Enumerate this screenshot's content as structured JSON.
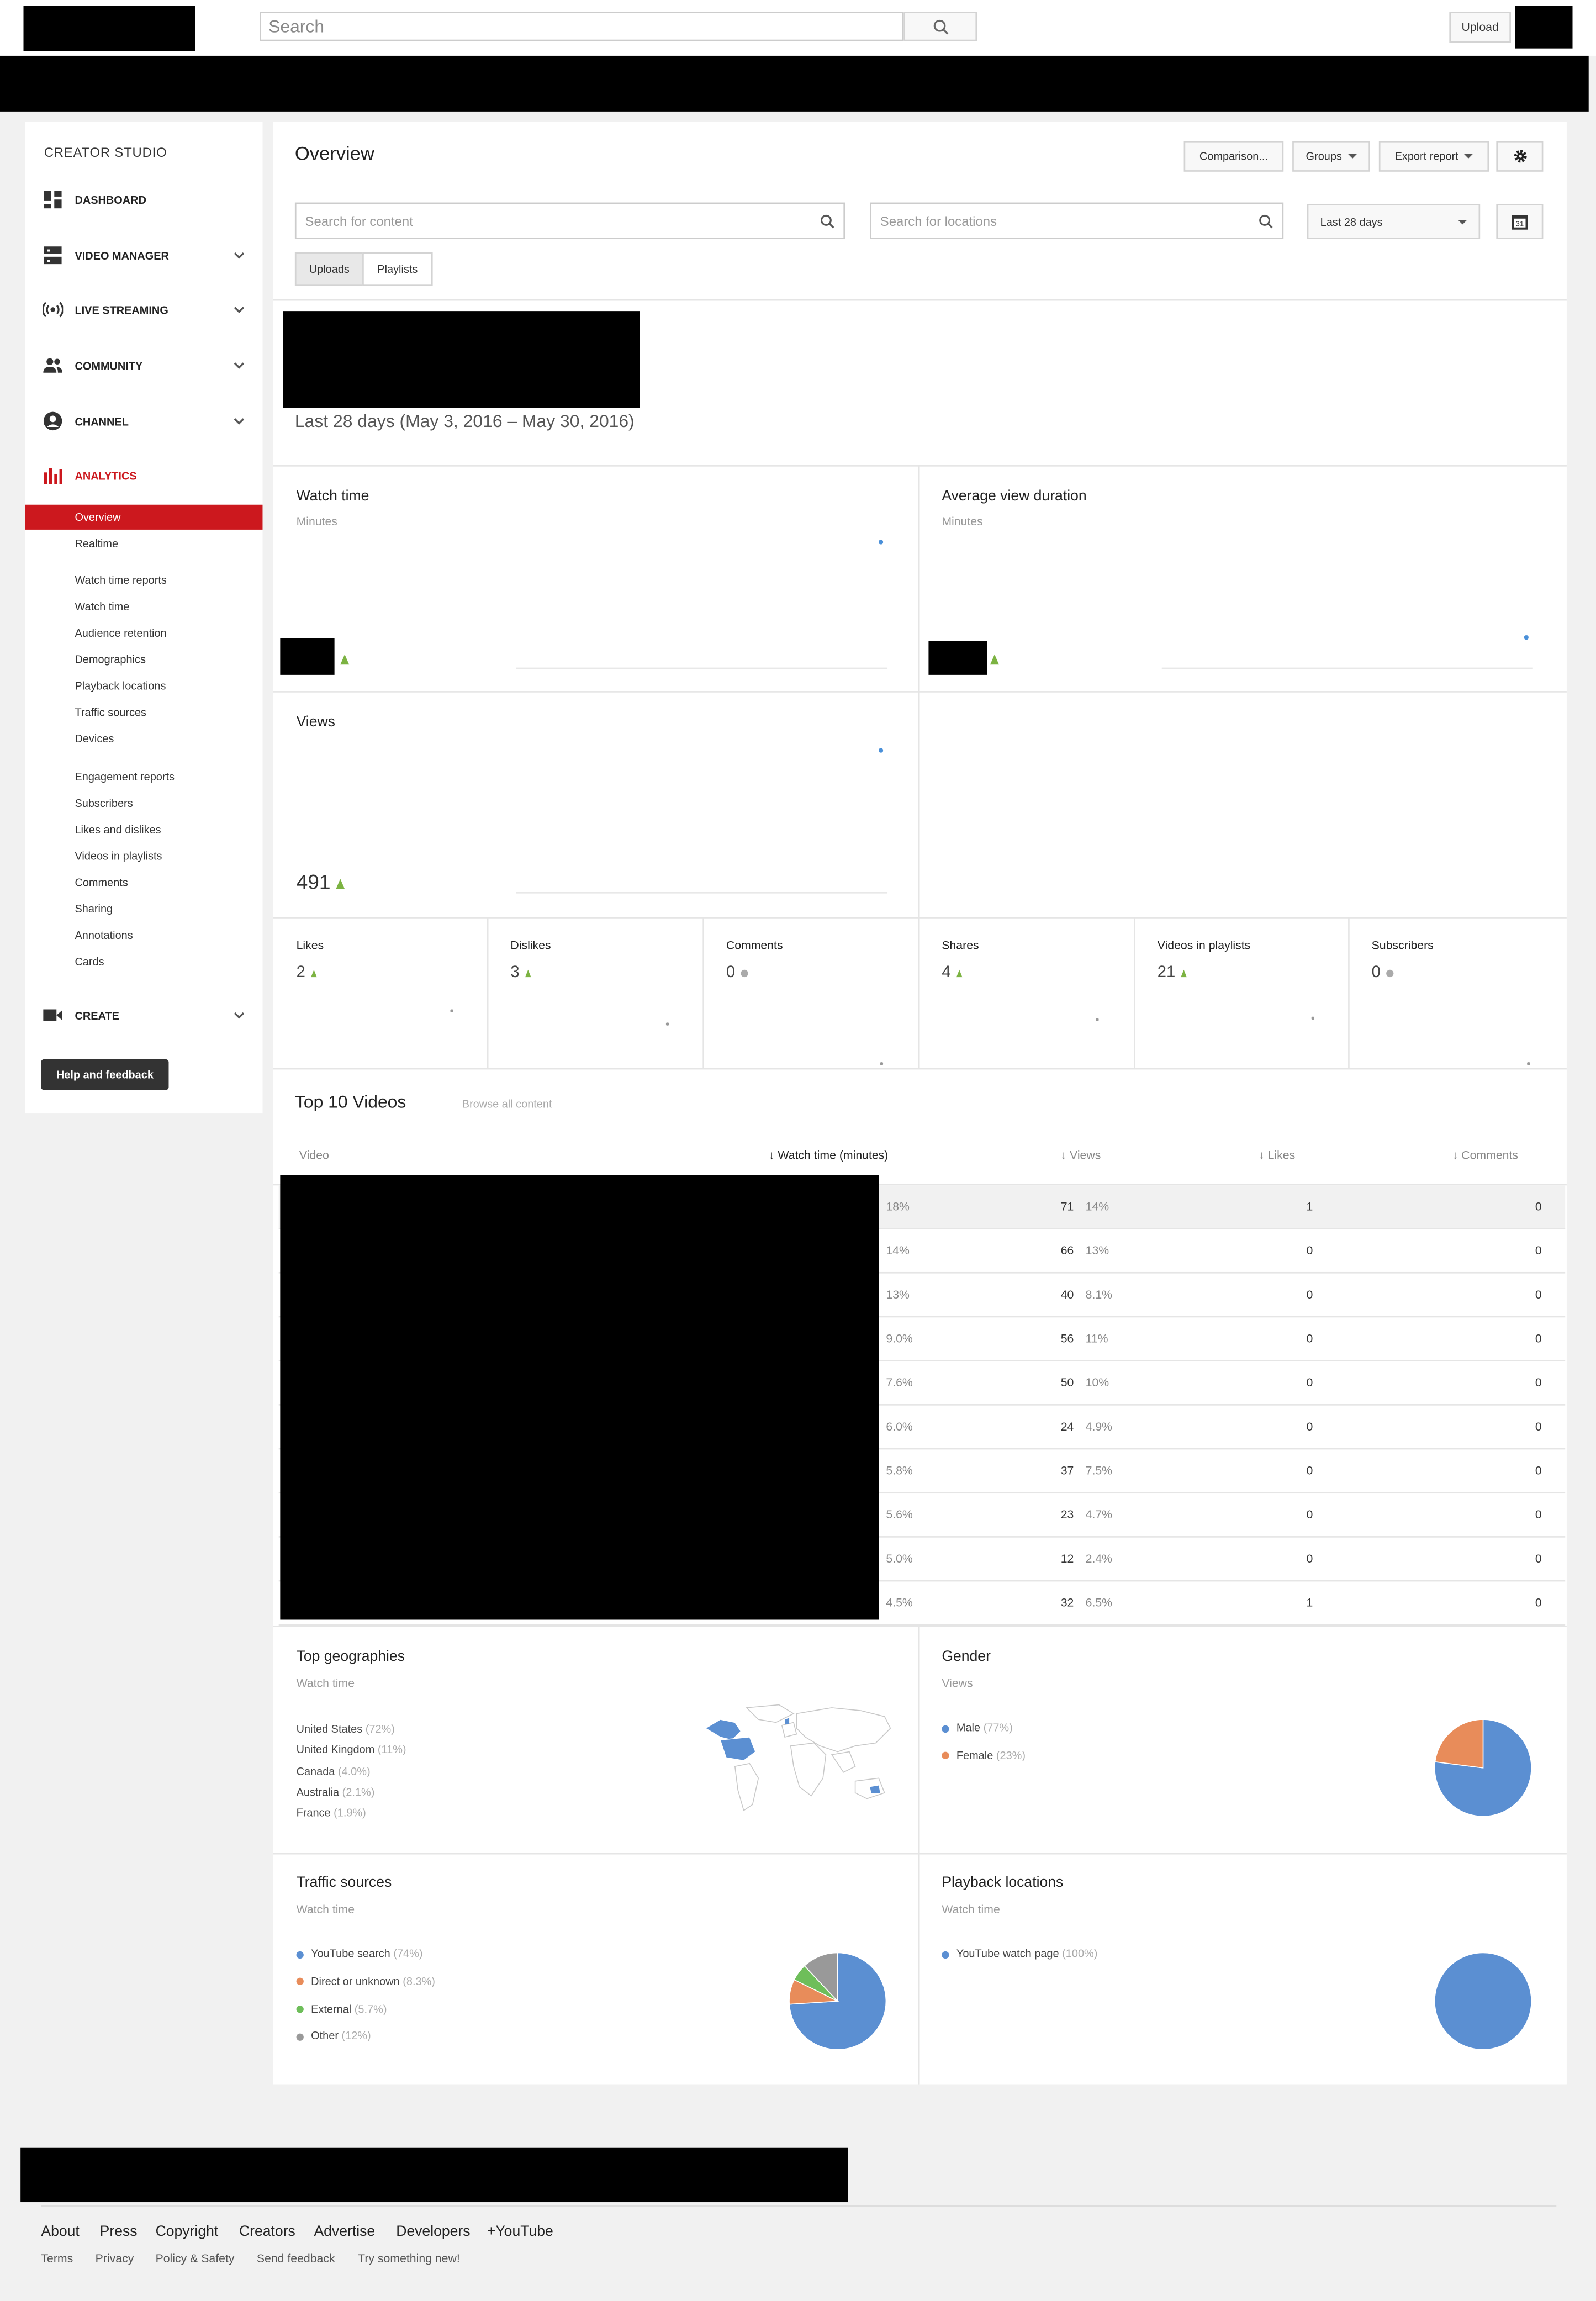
{
  "masthead": {
    "search_placeholder": "Search",
    "upload_label": "Upload"
  },
  "sidebar": {
    "title": "CREATOR STUDIO",
    "sections": {
      "dashboard": "DASHBOARD",
      "video_manager": "VIDEO MANAGER",
      "live_streaming": "LIVE STREAMING",
      "community": "COMMUNITY",
      "channel": "CHANNEL",
      "analytics": "ANALYTICS",
      "create": "CREATE"
    },
    "analytics_items": [
      "Overview",
      "Realtime",
      "Watch time reports",
      "Watch time",
      "Audience retention",
      "Demographics",
      "Playback locations",
      "Traffic sources",
      "Devices",
      "Engagement reports",
      "Subscribers",
      "Likes and dislikes",
      "Videos in playlists",
      "Comments",
      "Sharing",
      "Annotations",
      "Cards"
    ],
    "help_label": "Help and feedback"
  },
  "main": {
    "title": "Overview",
    "buttons": {
      "comparison": "Comparison...",
      "groups": "Groups",
      "export": "Export report"
    },
    "content_search_placeholder": "Search for content",
    "location_search_placeholder": "Search for locations",
    "date_select": "Last 28 days",
    "calendar_day": "31",
    "toggle": {
      "uploads": "Uploads",
      "playlists": "Playlists"
    },
    "date_range": "Last 28 days (May 3, 2016 – May 30, 2016)",
    "metrics": {
      "watch_time": {
        "title": "Watch time",
        "unit": "Minutes"
      },
      "avg_view_duration": {
        "title": "Average view duration",
        "unit": "Minutes"
      },
      "views": {
        "title": "Views",
        "value": "491"
      }
    },
    "mini_metrics": [
      {
        "title": "Likes",
        "value": "2",
        "trend": "up"
      },
      {
        "title": "Dislikes",
        "value": "3",
        "trend": "up"
      },
      {
        "title": "Comments",
        "value": "0",
        "trend": "flat"
      },
      {
        "title": "Shares",
        "value": "4",
        "trend": "up"
      },
      {
        "title": "Videos in playlists",
        "value": "21",
        "trend": "up"
      },
      {
        "title": "Subscribers",
        "value": "0",
        "trend": "flat"
      }
    ],
    "top_videos": {
      "title": "Top 10 Videos",
      "browse_link": "Browse all content",
      "headers": {
        "video": "Video",
        "watch_time": "Watch time (minutes)",
        "views": "Views",
        "likes": "Likes",
        "comments": "Comments"
      },
      "rows": [
        {
          "watch_pct": "18%",
          "views": "71",
          "views_pct": "14%",
          "likes": "1",
          "comments": "0"
        },
        {
          "watch_pct": "14%",
          "views": "66",
          "views_pct": "13%",
          "likes": "0",
          "comments": "0"
        },
        {
          "watch_pct": "13%",
          "views": "40",
          "views_pct": "8.1%",
          "likes": "0",
          "comments": "0"
        },
        {
          "watch_pct": "9.0%",
          "views": "56",
          "views_pct": "11%",
          "likes": "0",
          "comments": "0"
        },
        {
          "watch_pct": "7.6%",
          "views": "50",
          "views_pct": "10%",
          "likes": "0",
          "comments": "0"
        },
        {
          "watch_pct": "6.0%",
          "views": "24",
          "views_pct": "4.9%",
          "likes": "0",
          "comments": "0"
        },
        {
          "watch_pct": "5.8%",
          "views": "37",
          "views_pct": "7.5%",
          "likes": "0",
          "comments": "0"
        },
        {
          "watch_pct": "5.6%",
          "views": "23",
          "views_pct": "4.7%",
          "likes": "0",
          "comments": "0"
        },
        {
          "watch_pct": "5.0%",
          "views": "12",
          "views_pct": "2.4%",
          "likes": "0",
          "comments": "0"
        },
        {
          "watch_pct": "4.5%",
          "views": "32",
          "views_pct": "6.5%",
          "likes": "1",
          "comments": "0"
        }
      ]
    },
    "top_geographies": {
      "title": "Top geographies",
      "subtitle": "Watch time",
      "items": [
        {
          "name": "United States",
          "pct": "(72%)"
        },
        {
          "name": "United Kingdom",
          "pct": "(11%)"
        },
        {
          "name": "Canada",
          "pct": "(4.0%)"
        },
        {
          "name": "Australia",
          "pct": "(2.1%)"
        },
        {
          "name": "France",
          "pct": "(1.9%)"
        }
      ]
    },
    "gender": {
      "title": "Gender",
      "subtitle": "Views",
      "items": [
        {
          "name": "Male",
          "pct": "(77%)",
          "value": 77,
          "color": "#5b8fd2"
        },
        {
          "name": "Female",
          "pct": "(23%)",
          "value": 23,
          "color": "#e88c5a"
        }
      ]
    },
    "traffic_sources": {
      "title": "Traffic sources",
      "subtitle": "Watch time",
      "items": [
        {
          "name": "YouTube search",
          "pct": "(74%)",
          "value": 74,
          "color": "#5b8fd2"
        },
        {
          "name": "Direct or unknown",
          "pct": "(8.3%)",
          "value": 8.3,
          "color": "#e88c5a"
        },
        {
          "name": "External",
          "pct": "(5.7%)",
          "value": 5.7,
          "color": "#6ebe5a"
        },
        {
          "name": "Other",
          "pct": "(12%)",
          "value": 12,
          "color": "#999999"
        }
      ]
    },
    "playback_locations": {
      "title": "Playback locations",
      "subtitle": "Watch time",
      "items": [
        {
          "name": "YouTube watch page",
          "pct": "(100%)",
          "value": 100,
          "color": "#5b8fd2"
        }
      ]
    }
  },
  "footer": {
    "links": [
      "About",
      "Press",
      "Copyright",
      "Creators",
      "Advertise",
      "Developers",
      "+YouTube"
    ],
    "sublinks": [
      "Terms",
      "Privacy",
      "Policy & Safety",
      "Send feedback",
      "Try something new!"
    ]
  }
}
